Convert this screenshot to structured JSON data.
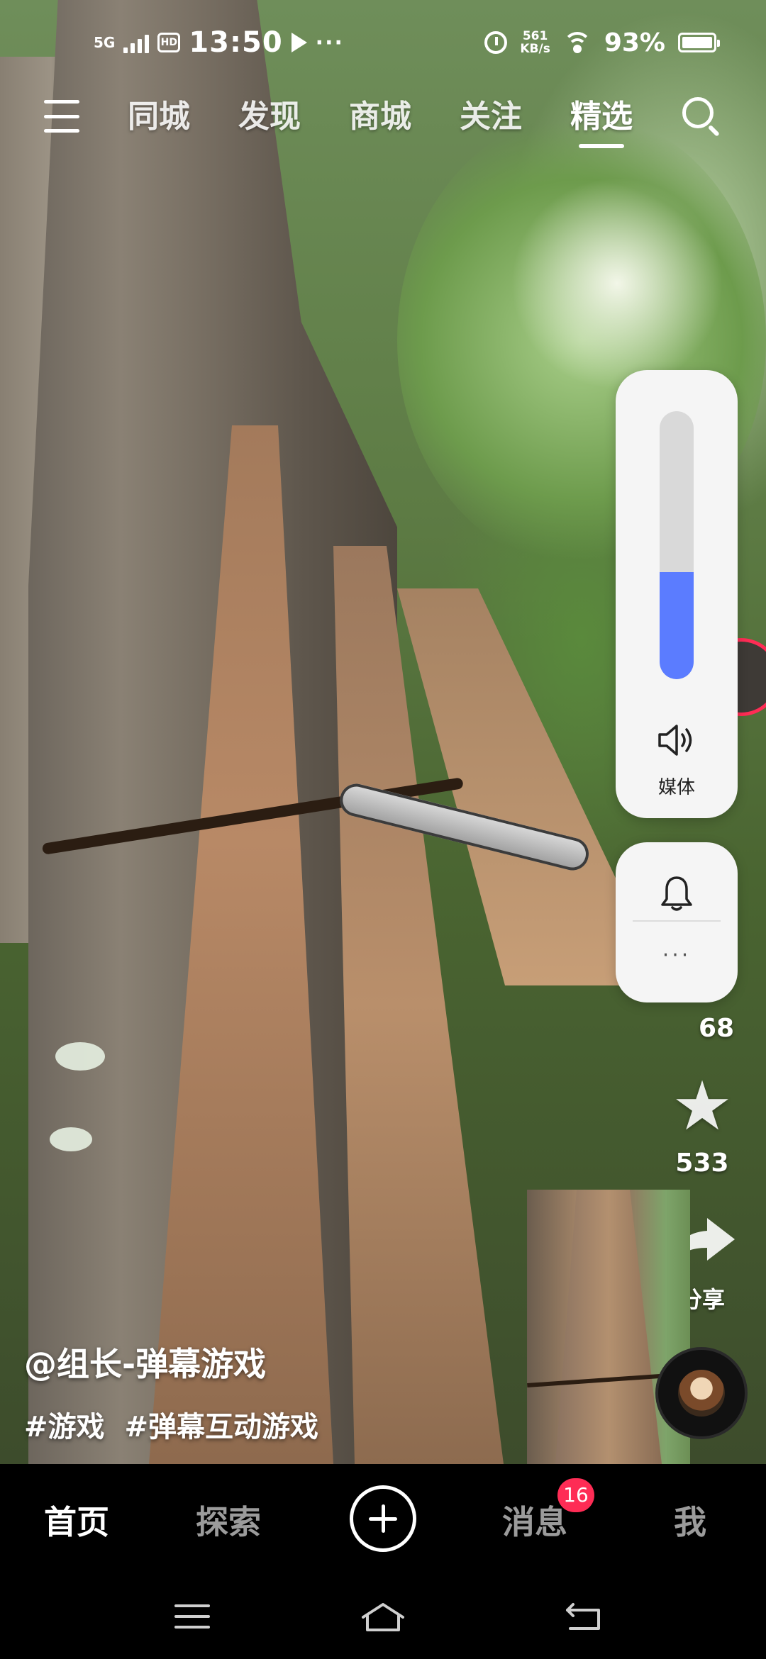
{
  "status_bar": {
    "network": "5G",
    "hd": "HD",
    "time": "13:50",
    "more": "···",
    "net_speed_value": "561",
    "net_speed_unit": "KB/s",
    "battery": "93%"
  },
  "top_nav": {
    "tabs": [
      {
        "label": "同城",
        "active": false
      },
      {
        "label": "发现",
        "active": false
      },
      {
        "label": "商城",
        "active": false
      },
      {
        "label": "关注",
        "active": false
      },
      {
        "label": "精选",
        "active": true
      }
    ]
  },
  "volume_panel": {
    "label": "媒体",
    "level": 0.4,
    "accent": "#5b7cff",
    "more": "···"
  },
  "side_actions": {
    "comment_count": "68",
    "favorite_count": "533",
    "share_label": "分享"
  },
  "caption": {
    "author": "@组长-弹幕游戏",
    "hashtags": [
      "#游戏",
      "#弹幕互动游戏"
    ]
  },
  "bottom_nav": {
    "items": [
      {
        "label": "首页",
        "active": true
      },
      {
        "label": "探索",
        "active": false
      },
      {
        "label": "消息",
        "active": false
      },
      {
        "label": "我",
        "active": false
      }
    ],
    "messages_badge": "16",
    "badge_color": "#fe2c55"
  }
}
